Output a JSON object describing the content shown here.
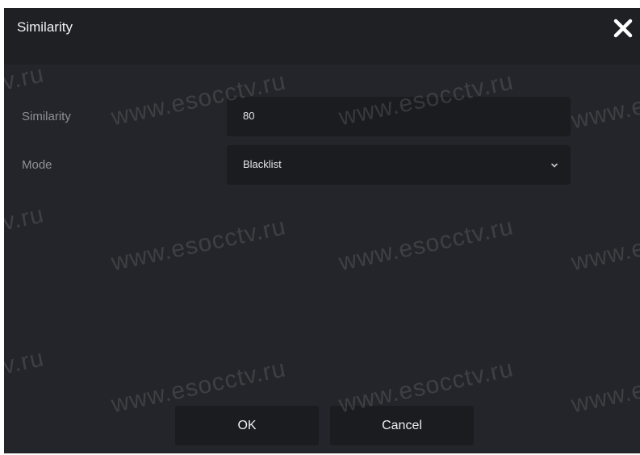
{
  "dialog": {
    "title": "Similarity",
    "close_icon": "close-icon"
  },
  "form": {
    "similarity": {
      "label": "Similarity",
      "value": "80"
    },
    "mode": {
      "label": "Mode",
      "value": "Blacklist",
      "icon": "chevron-down-icon"
    }
  },
  "buttons": {
    "ok": "OK",
    "cancel": "Cancel"
  },
  "watermark": {
    "text": "www.esocctv.ru",
    "partial_right": "tv.ru",
    "partial_left": "www.e"
  },
  "colors": {
    "background": "#23252a",
    "titlebar": "#1f2024",
    "field": "#1b1c20",
    "text": "#e6e6e6",
    "label": "#8e9096"
  }
}
